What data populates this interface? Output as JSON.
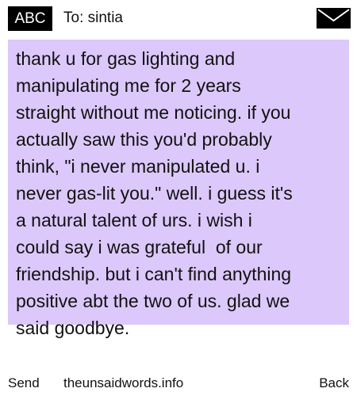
{
  "header": {
    "mode_label": "ABC",
    "to_prefix": "To:",
    "recipient": "sintia",
    "to_line": "To: sintia",
    "mail_icon": "envelope-icon"
  },
  "message": {
    "background_color": "#dcc8fa",
    "text": "thank u for gas lighting and\nmanipulating me for 2 years\nstraight without me noticing. if you\nactually saw this you'd probably\nthink, \"i never manipulated u. i\nnever gas-lit you.\" well. i guess it's\na natural talent of urs. i wish i\ncould say i was grateful  of our\nfriendship. but i can't find anything\npositive abt the two of us. glad we\nsaid goodbye."
  },
  "footer": {
    "send_label": "Send",
    "site_label": "theunsaidwords.info",
    "back_label": "Back"
  }
}
